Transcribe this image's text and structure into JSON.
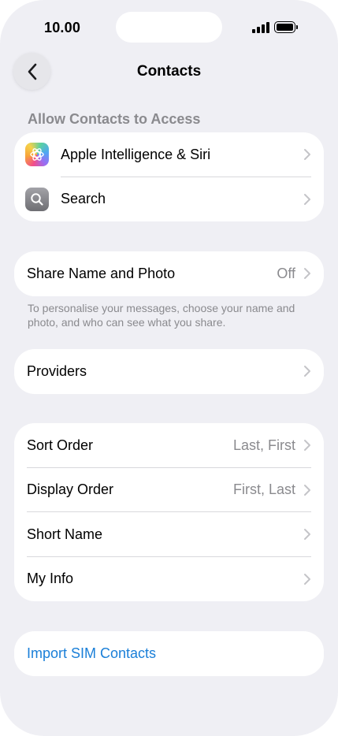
{
  "status_bar": {
    "time": "10.00"
  },
  "nav": {
    "title": "Contacts"
  },
  "access_section": {
    "header": "Allow Contacts to Access",
    "items": [
      {
        "label": "Apple Intelligence & Siri",
        "icon": "apple-intelligence-icon"
      },
      {
        "label": "Search",
        "icon": "search-icon"
      }
    ]
  },
  "share": {
    "label": "Share Name and Photo",
    "value": "Off"
  },
  "share_footer": "To personalise your messages, choose your name and photo, and who can see what you share.",
  "providers": {
    "label": "Providers"
  },
  "display_settings": {
    "items": [
      {
        "label": "Sort Order",
        "value": "Last, First"
      },
      {
        "label": "Display Order",
        "value": "First, Last"
      },
      {
        "label": "Short Name",
        "value": ""
      },
      {
        "label": "My Info",
        "value": ""
      }
    ]
  },
  "import": {
    "label": "Import SIM Contacts"
  },
  "colors": {
    "accent": "#1a7fd8",
    "background": "#efeff4",
    "secondary_text": "#8a8a8e"
  }
}
